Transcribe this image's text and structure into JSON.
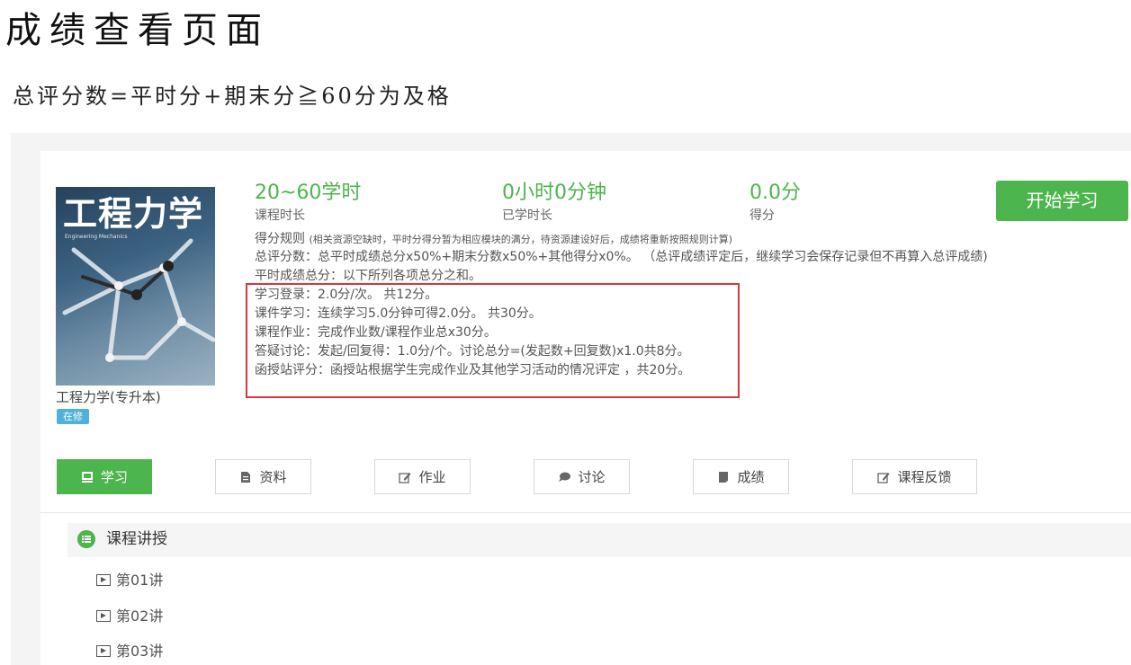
{
  "heading": "成绩查看页面",
  "formula": "总评分数=平时分+期末分≧60分为及格",
  "course": {
    "cover_title": "工程力学",
    "cover_subtitle": "Engineering Mechanics",
    "name": "工程力学(专升本)",
    "status_badge": "在修"
  },
  "stats": [
    {
      "value": "20~60学时",
      "label": "课程时长"
    },
    {
      "value": "0小时0分钟",
      "label": "已学时长"
    },
    {
      "value": "0.0分",
      "label": "得分"
    }
  ],
  "start_button": "开始学习",
  "rules": {
    "title": "得分规则",
    "note": "(相关资源空缺时，平时分得分暂为相应模块的满分，待资源建设好后，成绩将重新按照规则计算)",
    "total": "总评分数：总平时成绩总分x50%+期末分数x50%+其他得分x0%。  （总评成绩评定后，继续学习会保存记录但不再算入总评成绩)",
    "regular": "平时成绩总分：以下所列各项总分之和。",
    "items": [
      "学习登录：2.0分/次。 共12分。",
      "课件学习：连续学习5.0分钟可得2.0分。 共30分。",
      "课程作业：完成作业数/课程作业总x30分。",
      "答疑讨论：发起/回复得：1.0分/个。讨论总分=(发起数+回复数)x1.0共8分。",
      "函授站评分：函授站根据学生完成作业及其他学习活动的情况评定 ，共20分。"
    ]
  },
  "tabs": [
    {
      "label": "学习",
      "icon": "study-icon"
    },
    {
      "label": "资料",
      "icon": "document-icon"
    },
    {
      "label": "作业",
      "icon": "edit-icon"
    },
    {
      "label": "讨论",
      "icon": "chat-icon"
    },
    {
      "label": "成绩",
      "icon": "grade-icon"
    },
    {
      "label": "课程反馈",
      "icon": "edit-icon"
    }
  ],
  "section": {
    "title": "课程讲授",
    "icon": "list-icon",
    "lectures": [
      "第01讲",
      "第02讲",
      "第03讲"
    ]
  },
  "colors": {
    "accent": "#4cb54d",
    "highlight_border": "#d6393a",
    "badge": "#4fb1d8"
  }
}
